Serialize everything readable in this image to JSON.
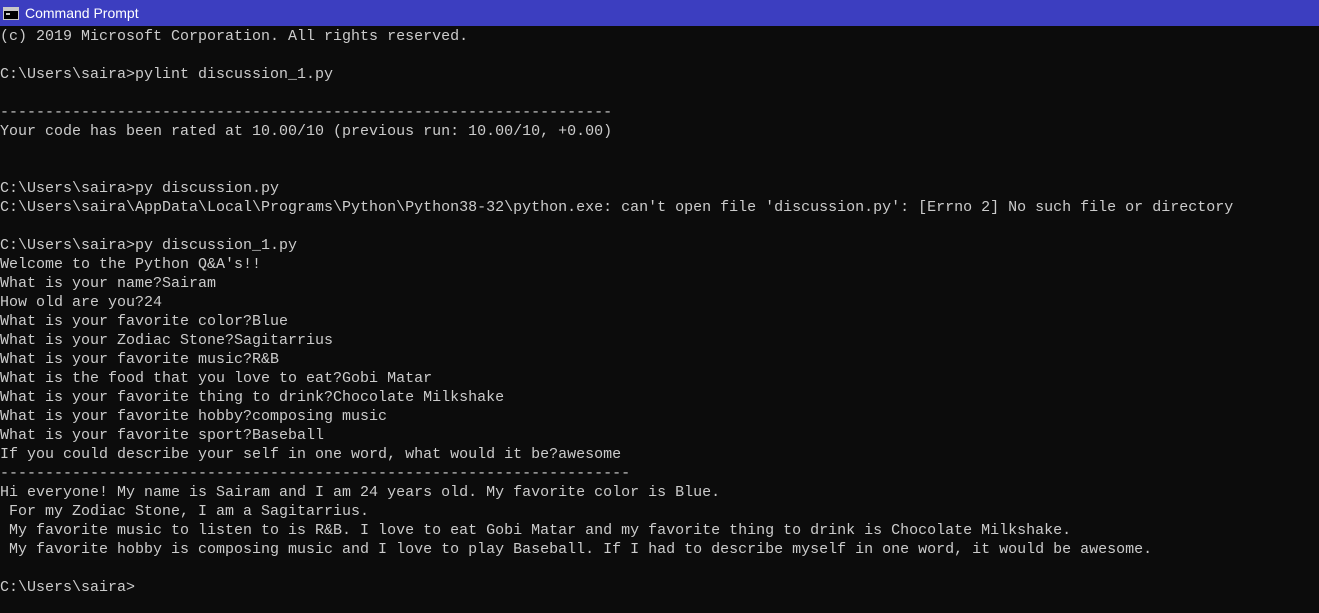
{
  "window": {
    "title": "Command Prompt",
    "icon": "console-icon"
  },
  "console": {
    "lines": [
      "(c) 2019 Microsoft Corporation. All rights reserved.",
      "",
      "C:\\Users\\saira>pylint discussion_1.py",
      "",
      "--------------------------------------------------------------------",
      "Your code has been rated at 10.00/10 (previous run: 10.00/10, +0.00)",
      "",
      "",
      "C:\\Users\\saira>py discussion.py",
      "C:\\Users\\saira\\AppData\\Local\\Programs\\Python\\Python38-32\\python.exe: can't open file 'discussion.py': [Errno 2] No such file or directory",
      "",
      "C:\\Users\\saira>py discussion_1.py",
      "Welcome to the Python Q&A's!!",
      "What is your name?Sairam",
      "How old are you?24",
      "What is your favorite color?Blue",
      "What is your Zodiac Stone?Sagitarrius",
      "What is your favorite music?R&B",
      "What is the food that you love to eat?Gobi Matar",
      "What is your favorite thing to drink?Chocolate Milkshake",
      "What is your favorite hobby?composing music",
      "What is your favorite sport?Baseball",
      "If you could describe your self in one word, what would it be?awesome",
      "----------------------------------------------------------------------",
      "Hi everyone! My name is Sairam and I am 24 years old. My favorite color is Blue.",
      " For my Zodiac Stone, I am a Sagitarrius.",
      " My favorite music to listen to is R&B. I love to eat Gobi Matar and my favorite thing to drink is Chocolate Milkshake.",
      " My favorite hobby is composing music and I love to play Baseball. If I had to describe myself in one word, it would be awesome.",
      "",
      "C:\\Users\\saira>"
    ]
  },
  "colors": {
    "titlebar": "#3c3ec0",
    "background": "#0c0c0c",
    "text": "#cccccc"
  }
}
